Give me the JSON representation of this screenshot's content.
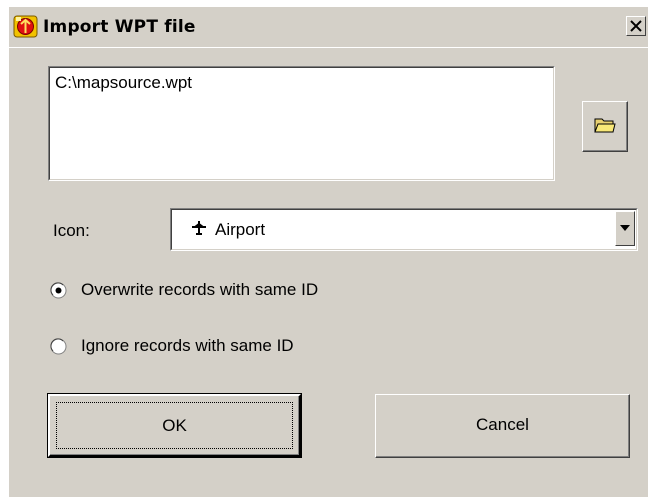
{
  "window": {
    "title": "Import WPT file",
    "close_icon": "close-icon",
    "app_icon": "app-icon"
  },
  "file": {
    "path": "C:\\mapsource.wpt",
    "browse_icon": "folder-icon"
  },
  "icon_select": {
    "label": "Icon:",
    "value": "Airport",
    "value_icon": "airplane-icon",
    "dropdown_icon": "chevron-down-icon"
  },
  "options": {
    "overwrite": {
      "label": "Overwrite records with same ID",
      "selected": true
    },
    "ignore": {
      "label": "Ignore records with same ID",
      "selected": false
    }
  },
  "buttons": {
    "ok": "OK",
    "cancel": "Cancel"
  },
  "colors": {
    "dialog_bg": "#d4d0c8",
    "field_bg": "#ffffff"
  }
}
